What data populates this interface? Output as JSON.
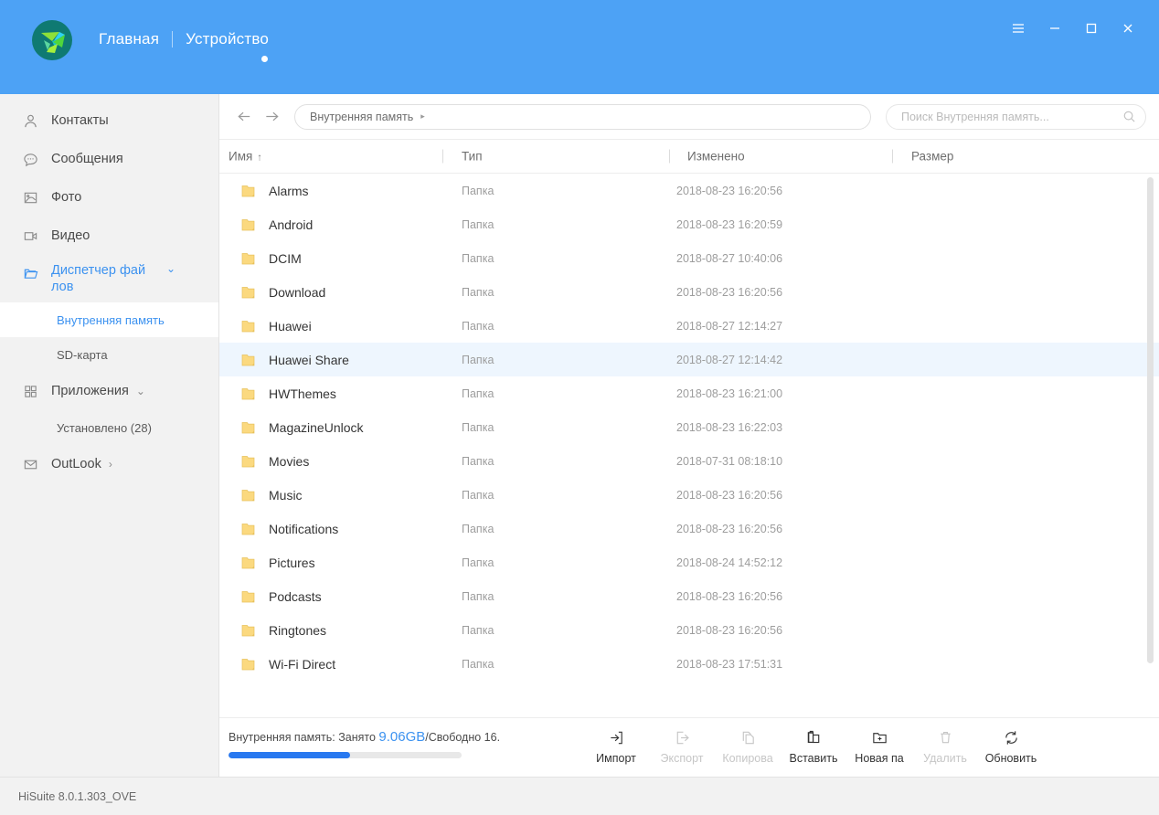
{
  "titlebar": {
    "logo_icon": "hisuite-logo-icon",
    "links": [
      {
        "label": "Главная"
      },
      {
        "label": "Устройство"
      }
    ],
    "window_controls": [
      {
        "name": "menu-icon",
        "label": "☰"
      },
      {
        "name": "minimize-icon",
        "label": "–"
      },
      {
        "name": "maximize-icon",
        "label": "□"
      },
      {
        "name": "close-icon",
        "label": "✕"
      }
    ]
  },
  "sidebar": {
    "items": [
      {
        "label": "Контакты",
        "icon": "contacts-icon",
        "type": "item"
      },
      {
        "label": "Сообщения",
        "icon": "messages-icon",
        "type": "item"
      },
      {
        "label": "Фото",
        "icon": "photo-icon",
        "type": "item"
      },
      {
        "label": "Видео",
        "icon": "video-icon",
        "type": "item"
      },
      {
        "label": "Диспетчер фай лов",
        "icon": "folder-icon",
        "type": "group",
        "expanded": true,
        "chevron": "⌄"
      },
      {
        "label": "Внутренняя память",
        "type": "sub",
        "selected": true
      },
      {
        "label": "SD-карта",
        "type": "sub",
        "selected": false
      },
      {
        "label": "Приложения",
        "icon": "apps-grid-icon",
        "type": "group",
        "expanded": true,
        "chevron": "⌄"
      },
      {
        "label": "Установлено (28)",
        "type": "sub",
        "selected": false
      },
      {
        "label": "OutLook",
        "icon": "mail-icon",
        "type": "group",
        "expanded": false,
        "chevron": "›"
      }
    ]
  },
  "toolbar": {
    "back_icon": "arrow-left-icon",
    "forward_icon": "arrow-right-icon",
    "breadcrumb": "Внутренняя память",
    "breadcrumb_arrow": "▸",
    "search_placeholder": "Поиск Внутренняя память...",
    "search_value": "",
    "search_icon": "search-icon"
  },
  "columns": [
    {
      "label": "Имя",
      "sort": "↑"
    },
    {
      "label": "Тип",
      "sort": ""
    },
    {
      "label": "Изменено",
      "sort": ""
    },
    {
      "label": "Размер",
      "sort": ""
    }
  ],
  "files": [
    {
      "name": "Alarms",
      "type": "Папка",
      "modified": "2018-08-23 16:20:56",
      "size": "",
      "selected": false
    },
    {
      "name": "Android",
      "type": "Папка",
      "modified": "2018-08-23 16:20:59",
      "size": "",
      "selected": false
    },
    {
      "name": "DCIM",
      "type": "Папка",
      "modified": "2018-08-27 10:40:06",
      "size": "",
      "selected": false
    },
    {
      "name": "Download",
      "type": "Папка",
      "modified": "2018-08-23 16:20:56",
      "size": "",
      "selected": false
    },
    {
      "name": "Huawei",
      "type": "Папка",
      "modified": "2018-08-27 12:14:27",
      "size": "",
      "selected": false
    },
    {
      "name": "Huawei Share",
      "type": "Папка",
      "modified": "2018-08-27 12:14:42",
      "size": "",
      "selected": true
    },
    {
      "name": "HWThemes",
      "type": "Папка",
      "modified": "2018-08-23 16:21:00",
      "size": "",
      "selected": false
    },
    {
      "name": "MagazineUnlock",
      "type": "Папка",
      "modified": "2018-08-23 16:22:03",
      "size": "",
      "selected": false
    },
    {
      "name": "Movies",
      "type": "Папка",
      "modified": "2018-07-31 08:18:10",
      "size": "",
      "selected": false
    },
    {
      "name": "Music",
      "type": "Папка",
      "modified": "2018-08-23 16:20:56",
      "size": "",
      "selected": false
    },
    {
      "name": "Notifications",
      "type": "Папка",
      "modified": "2018-08-23 16:20:56",
      "size": "",
      "selected": false
    },
    {
      "name": "Pictures",
      "type": "Папка",
      "modified": "2018-08-24 14:52:12",
      "size": "",
      "selected": false
    },
    {
      "name": "Podcasts",
      "type": "Папка",
      "modified": "2018-08-23 16:20:56",
      "size": "",
      "selected": false
    },
    {
      "name": "Ringtones",
      "type": "Папка",
      "modified": "2018-08-23 16:20:56",
      "size": "",
      "selected": false
    },
    {
      "name": "Wi-Fi Direct",
      "type": "Папка",
      "modified": "2018-08-23 17:51:31",
      "size": "",
      "selected": false
    }
  ],
  "status": {
    "prefix": "Внутренняя память: Занято ",
    "used": "9.06GB",
    "suffix": "/Свободно 16.",
    "progress_percent": 52
  },
  "actions": [
    {
      "label": "Импорт",
      "icon": "import-icon",
      "disabled": false
    },
    {
      "label": "Экспорт",
      "icon": "export-icon",
      "disabled": true
    },
    {
      "label": "Копирова",
      "icon": "copy-icon",
      "disabled": true
    },
    {
      "label": "Вставить",
      "icon": "paste-icon",
      "disabled": false
    },
    {
      "label": "Новая па",
      "icon": "new-folder-icon",
      "disabled": false
    },
    {
      "label": "Удалить",
      "icon": "trash-icon",
      "disabled": true
    },
    {
      "label": "Обновить",
      "icon": "refresh-icon",
      "disabled": false
    }
  ],
  "footer": {
    "version": "HiSuite 8.0.1.303_OVE"
  },
  "colors": {
    "accent": "#4da2f5",
    "accent_dark": "#2979f0",
    "selected_row": "#eef6fe",
    "sidebar_bg": "#f2f2f2",
    "folder": "#fbd97f"
  }
}
